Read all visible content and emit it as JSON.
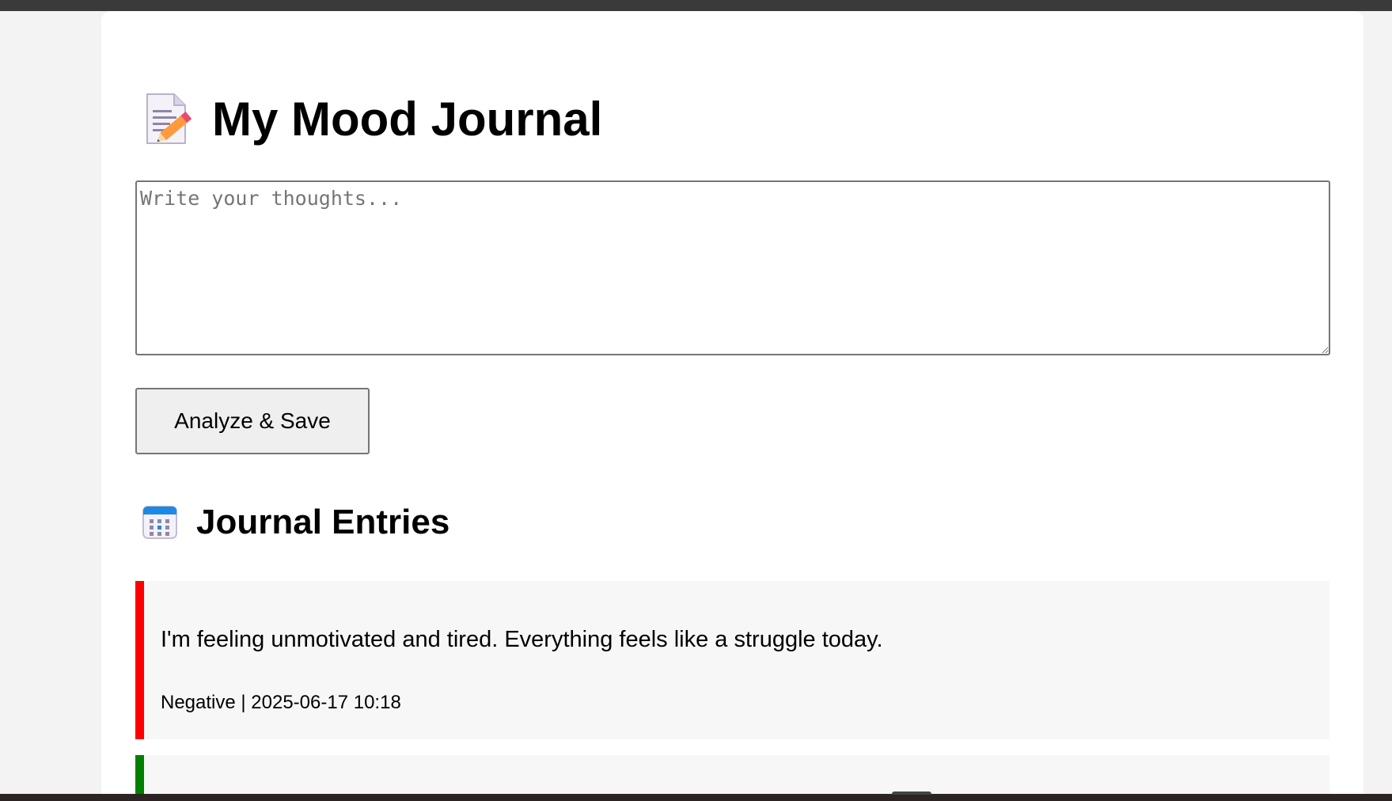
{
  "header": {
    "title": "My Mood Journal",
    "icon": "memo-icon"
  },
  "composer": {
    "placeholder": "Write your thoughts...",
    "value": "",
    "button_label": "Analyze & Save"
  },
  "entries_section": {
    "title": "Journal Entries",
    "icon": "calendar-icon"
  },
  "entries": [
    {
      "text": "I'm feeling unmotivated and tired. Everything feels like a struggle today.",
      "meta": "Negative | 2025-06-17 10:18",
      "color": "#ff0000"
    },
    {
      "text": "",
      "meta": "",
      "color": "#008000"
    }
  ],
  "colors": {
    "negative": "#ff0000",
    "positive": "#008000",
    "card_background": "#ffffff",
    "page_background": "#f3f3f3"
  }
}
